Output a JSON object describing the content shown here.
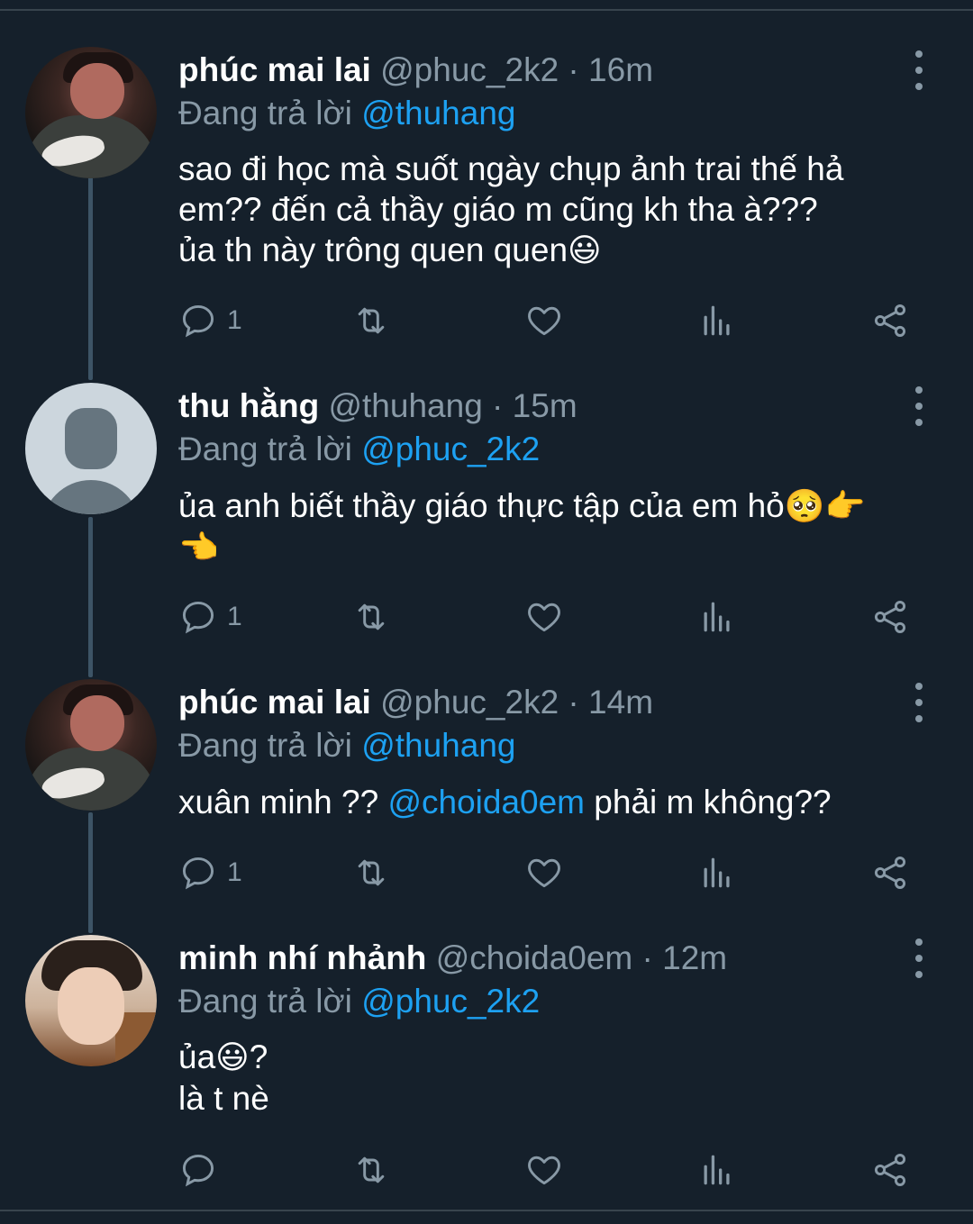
{
  "tweets": [
    {
      "name": "phúc mai lai",
      "handle": "@phuc_2k2",
      "sep": " · ",
      "time": "16m",
      "replying_prefix": "Đang trả lời ",
      "replying_to": "@thuhang",
      "lines": [
        "sao đi học mà suốt ngày chụp ảnh trai thế hả",
        "em?? đến cả thầy giáo m cũng kh tha à???",
        "ủa th này trông quen quen"
      ],
      "emoji_end": "😃",
      "reply_count": "1"
    },
    {
      "name": "thu hằng",
      "handle": "@thuhang",
      "sep": " · ",
      "time": "15m",
      "replying_prefix": "Đang trả lời ",
      "replying_to": "@phuc_2k2",
      "line1": "ủa anh biết thầy giáo thực tập của em hỏ",
      "emoji1": "🥺👉",
      "emoji2": "👈",
      "reply_count": "1"
    },
    {
      "name": "phúc mai lai",
      "handle": "@phuc_2k2",
      "sep": " · ",
      "time": "14m",
      "replying_prefix": "Đang trả lời ",
      "replying_to": "@thuhang",
      "text_pre": "xuân minh ?? ",
      "text_mention": "@choida0em",
      "text_post": " phải m không??",
      "reply_count": "1"
    },
    {
      "name": "minh nhí nhảnh",
      "handle": "@choida0em",
      "sep": " · ",
      "time": "12m",
      "replying_prefix": "Đang trả lời ",
      "replying_to": "@phuc_2k2",
      "line1_pre": "ủa",
      "line1_emoji": "😃",
      "line1_post": "?",
      "line2": "là t nè",
      "reply_count": ""
    }
  ],
  "icons": [
    "reply-icon",
    "retweet-icon",
    "like-icon",
    "stats-icon",
    "share-icon",
    "more-icon"
  ],
  "colors": {
    "background": "#15202b",
    "accent": "#1da1f2",
    "muted": "#8899a6",
    "thread": "#3d5466"
  }
}
